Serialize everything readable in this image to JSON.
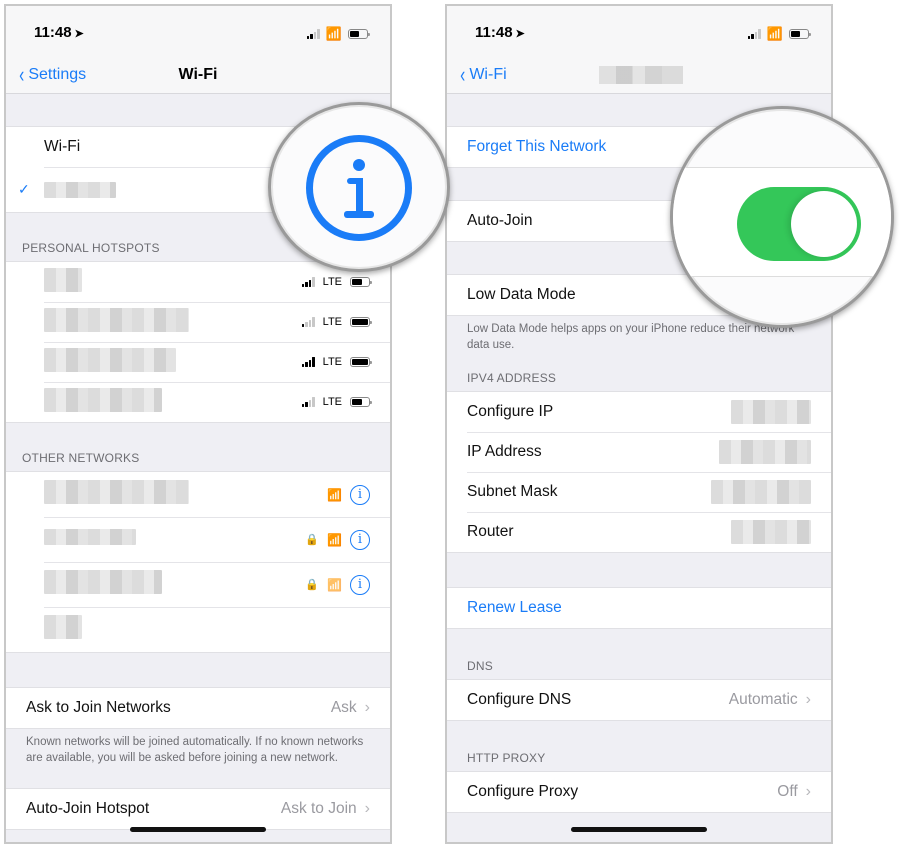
{
  "left": {
    "status": {
      "time": "11:48",
      "location_icon": "location-arrow-icon"
    },
    "nav": {
      "back_label": "Settings",
      "title": "Wi-Fi"
    },
    "wifi_toggle_label": "Wi-Fi",
    "personal_hotspots": {
      "header": "PERSONAL HOTSPOTS",
      "items": [
        {
          "name_redacted": true,
          "signal_bars": 3,
          "network_type": "LTE",
          "battery_level": 0.6
        },
        {
          "name_redacted": true,
          "signal_bars": 1,
          "network_type": "LTE",
          "battery_level": 1.0
        },
        {
          "name_redacted": true,
          "signal_bars": 4,
          "network_type": "LTE",
          "battery_level": 1.0
        },
        {
          "name_redacted": true,
          "signal_bars": 2,
          "network_type": "LTE",
          "battery_level": 0.6
        }
      ]
    },
    "other_networks": {
      "header": "OTHER NETWORKS",
      "items": [
        {
          "name_redacted": true,
          "locked": false,
          "wifi_strength": "full",
          "info_icon": "i"
        },
        {
          "name_redacted": true,
          "locked": true,
          "wifi_strength": "full",
          "info_icon": "i"
        },
        {
          "name_redacted": true,
          "locked": true,
          "wifi_strength": "medium",
          "info_icon": "i"
        },
        {
          "name_redacted": true,
          "locked": false,
          "wifi_strength": "none",
          "info_icon": ""
        }
      ]
    },
    "ask_to_join": {
      "label": "Ask to Join Networks",
      "value": "Ask",
      "chevron": "›"
    },
    "ask_to_join_footer": "Known networks will be joined automatically. If no known networks are available, you will be asked before joining a new network.",
    "auto_join_hotspot": {
      "label": "Auto-Join Hotspot",
      "value": "Ask to Join",
      "chevron": "›"
    }
  },
  "right": {
    "status": {
      "time": "11:48"
    },
    "nav": {
      "back_label": "Wi-Fi",
      "title_redacted": true
    },
    "forget_network": "Forget This Network",
    "auto_join": {
      "label": "Auto-Join",
      "enabled": true
    },
    "low_data_mode": {
      "label": "Low Data Mode"
    },
    "low_data_footer": "Low Data Mode helps apps on your iPhone reduce their network data use.",
    "ipv4": {
      "header": "IPV4 ADDRESS",
      "rows": [
        {
          "label": "Configure IP",
          "value_redacted": true
        },
        {
          "label": "IP Address",
          "value_redacted": true
        },
        {
          "label": "Subnet Mask",
          "value_redacted": true
        },
        {
          "label": "Router",
          "value_redacted": true
        }
      ]
    },
    "renew_lease": "Renew Lease",
    "dns": {
      "header": "DNS",
      "label": "Configure DNS",
      "value": "Automatic",
      "chevron": "›"
    },
    "proxy": {
      "header": "HTTP PROXY",
      "label": "Configure Proxy",
      "value": "Off",
      "chevron": "›"
    }
  },
  "colors": {
    "accent": "#1a7cf7",
    "toggle_on": "#34c759",
    "background": "#efeff4"
  }
}
